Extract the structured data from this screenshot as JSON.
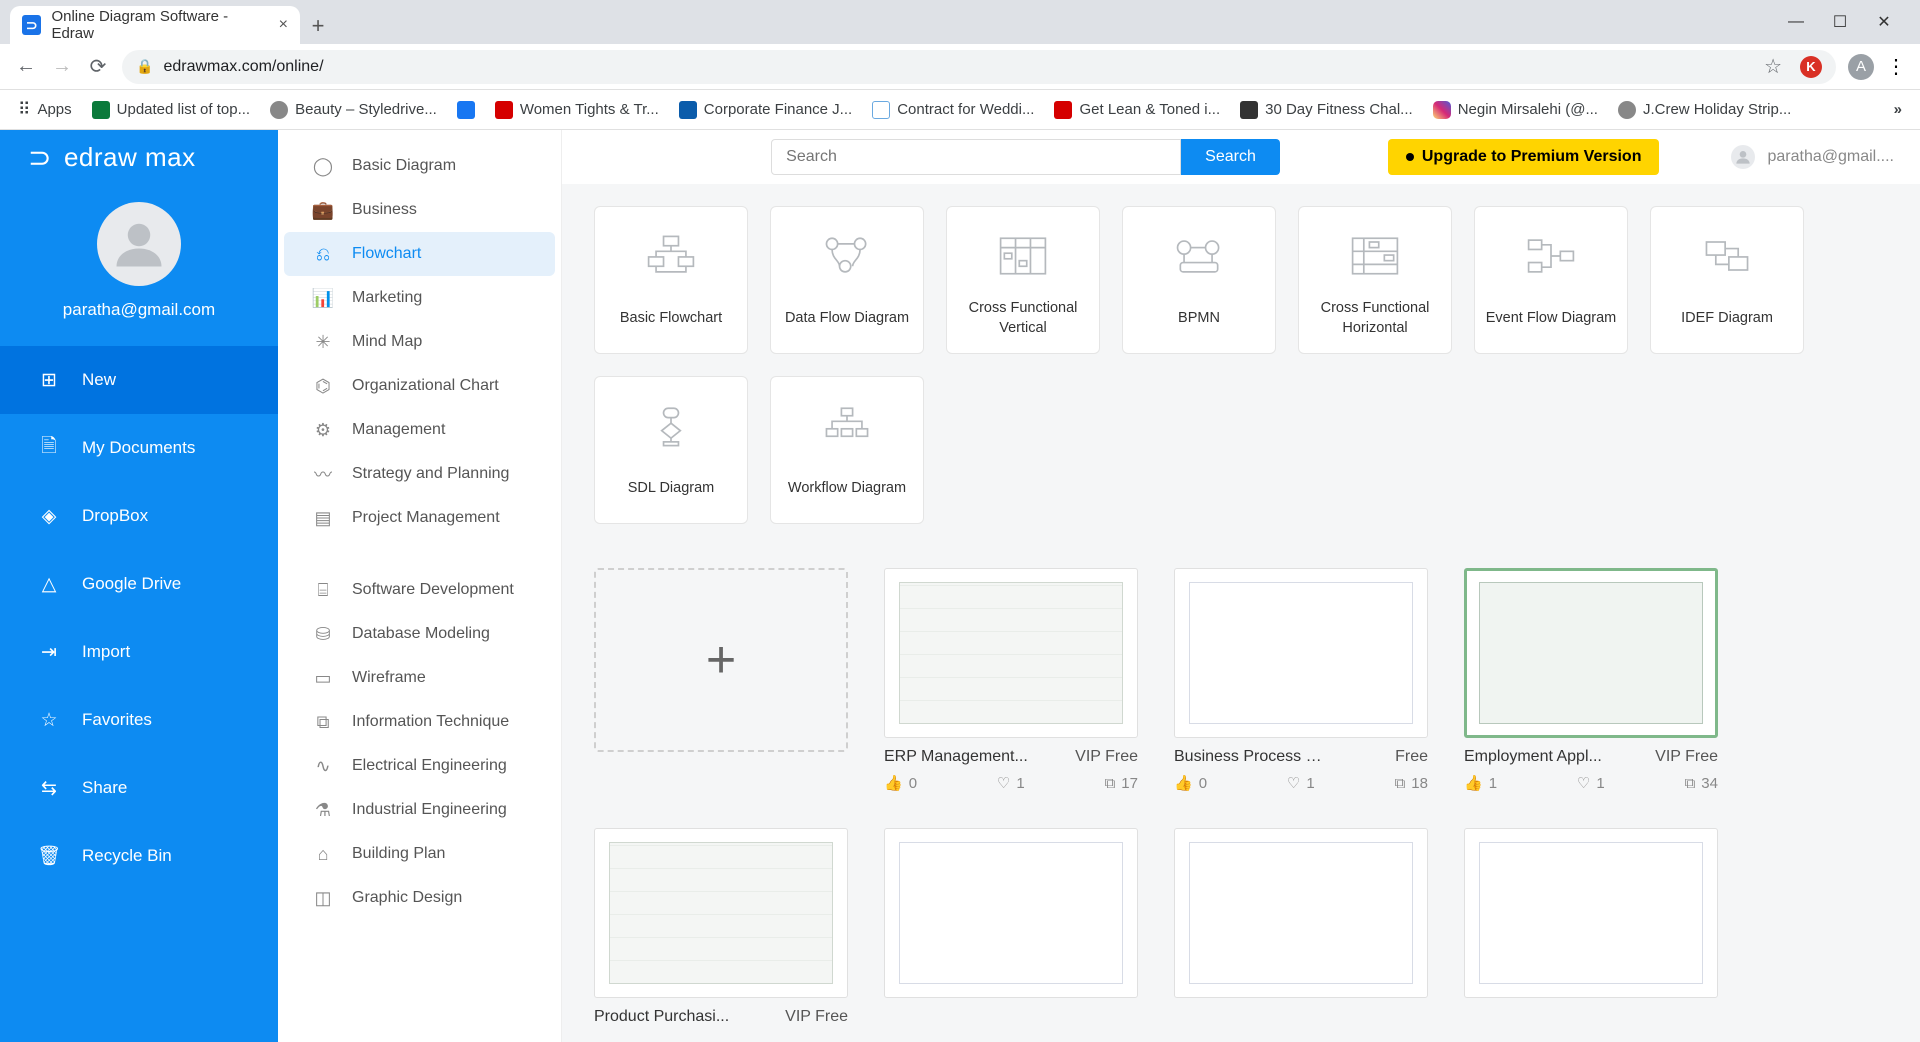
{
  "browser": {
    "tab_title": "Online Diagram Software - Edraw",
    "url": "edrawmax.com/online/",
    "bookmarks": [
      {
        "label": "Apps",
        "icon_color": ""
      },
      {
        "label": "Updated list of top...",
        "icon_color": "#0b7a3b"
      },
      {
        "label": "Beauty – Styledrive...",
        "icon_color": "#888"
      },
      {
        "label": "",
        "icon_color": "#1877f2"
      },
      {
        "label": "Women Tights & Tr...",
        "icon_color": "#d50000"
      },
      {
        "label": "Corporate Finance J...",
        "icon_color": "#0b5cab"
      },
      {
        "label": "Contract for Weddi...",
        "icon_color": "#6aa9e0"
      },
      {
        "label": "Get Lean & Toned i...",
        "icon_color": "#d50000"
      },
      {
        "label": "30 Day Fitness Chal...",
        "icon_color": "#333"
      },
      {
        "label": "Negin Mirsalehi (@...",
        "icon_color": "#e1306c"
      },
      {
        "label": "J.Crew Holiday Strip...",
        "icon_color": "#888"
      }
    ]
  },
  "app": {
    "logo": "edraw max",
    "user_email": "paratha@gmail.com",
    "user_email_short": "paratha@gmail....",
    "left_nav": [
      {
        "label": "New",
        "active": true
      },
      {
        "label": "My Documents"
      },
      {
        "label": "DropBox"
      },
      {
        "label": "Google Drive"
      },
      {
        "label": "Import"
      },
      {
        "label": "Favorites"
      },
      {
        "label": "Share"
      },
      {
        "label": "Recycle Bin"
      }
    ],
    "categories_a": [
      "Basic Diagram",
      "Business",
      "Flowchart",
      "Marketing",
      "Mind Map",
      "Organizational Chart",
      "Management",
      "Strategy and Planning",
      "Project Management"
    ],
    "categories_b": [
      "Software Development",
      "Database Modeling",
      "Wireframe",
      "Information Technique",
      "Electrical Engineering",
      "Industrial Engineering",
      "Building Plan",
      "Graphic Design"
    ],
    "cat_active": "Flowchart",
    "search_placeholder": "Search",
    "search_button": "Search",
    "upgrade_label": "Upgrade to Premium Version",
    "templates": [
      "Basic Flowchart",
      "Data Flow Diagram",
      "Cross Functional Vertical",
      "BPMN",
      "Cross Functional Horizontal",
      "Event Flow Diagram",
      "IDEF Diagram",
      "SDL Diagram",
      "Workflow Diagram"
    ],
    "gallery": [
      {
        "title": "ERP Management...",
        "price": "VIP Free",
        "likes": 0,
        "hearts": 1,
        "copies": 17
      },
      {
        "title": "Business Process Mo...",
        "price": "Free",
        "likes": 0,
        "hearts": 1,
        "copies": 18
      },
      {
        "title": "Employment Appl...",
        "price": "VIP Free",
        "likes": 1,
        "hearts": 1,
        "copies": 34
      },
      {
        "title": "Product Purchasi...",
        "price": "VIP Free"
      }
    ]
  }
}
